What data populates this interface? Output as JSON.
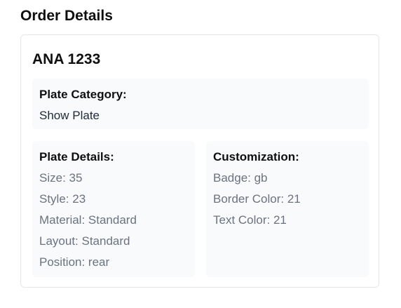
{
  "page": {
    "title": "Order Details"
  },
  "order": {
    "plate_number": "ANA 1233",
    "category": {
      "label": "Plate Category:",
      "value": "Show Plate"
    },
    "plate_details": {
      "label": "Plate Details:",
      "fields": [
        "Size: 35",
        "Style: 23",
        "Material: Standard",
        "Layout: Standard",
        "Position: rear"
      ]
    },
    "customization": {
      "label": "Customization:",
      "fields": [
        "Badge: gb",
        "Border Color: 21",
        "Text Color: 21"
      ]
    }
  }
}
